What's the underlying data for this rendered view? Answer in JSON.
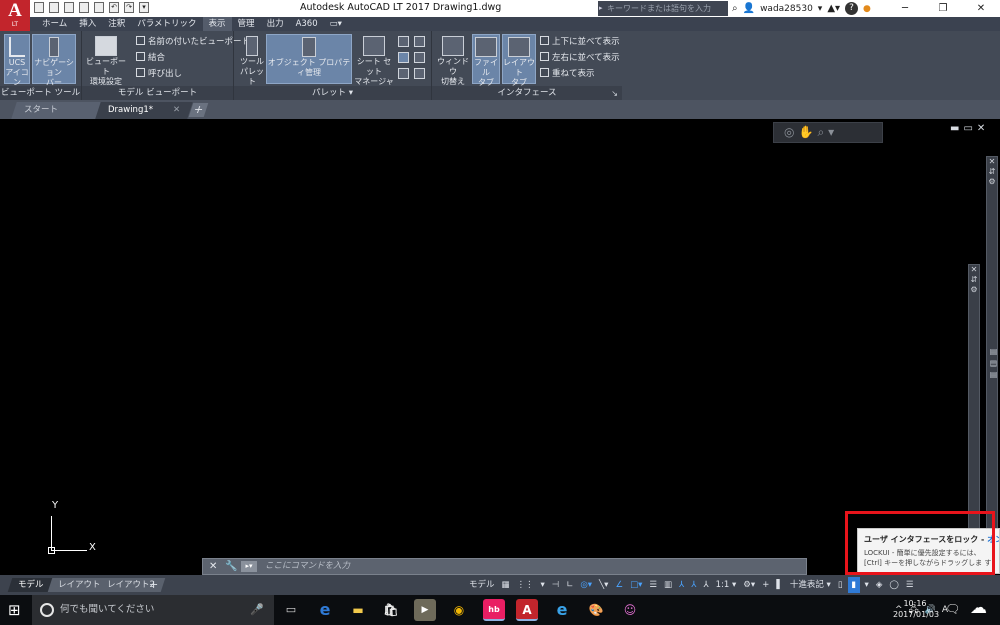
{
  "titlebar": {
    "app_logo_letter": "A",
    "app_logo_sub": "LT",
    "title": "Autodesk AutoCAD LT 2017    Drawing1.dwg",
    "search_placeholder": "キーワードまたは語句を入力",
    "username": "wada28530",
    "help": "?"
  },
  "menu_tabs": [
    "ホーム",
    "挿入",
    "注釈",
    "パラメトリック",
    "表示",
    "管理",
    "出力",
    "A360",
    "▭▾"
  ],
  "menu_active": "表示",
  "ribbon": {
    "viewport_tools": {
      "title": "ビューポート ツール ▾",
      "ucs_icon": "UCS\nアイコン",
      "ucs_l1": "UCS",
      "ucs_l2": "アイコン",
      "nav_l1": "ナビゲーション",
      "nav_l2": "バー"
    },
    "model_viewport": {
      "title": "モデル ビューポート",
      "config_l1": "ビューポート",
      "config_l2": "環境設定",
      "named": "名前の付いたビューポート",
      "join": "結合",
      "restore": "呼び出し"
    },
    "palette": {
      "title": "パレット ▾",
      "tool_l1": "ツール",
      "tool_l2": "パレット",
      "properties": "オブジェクト プロパティ管理",
      "sheetset_l1": "シート セット",
      "sheetset_l2": "マネージャ"
    },
    "interface": {
      "title": "インタフェース",
      "switch_l1": "ウィンドウ",
      "switch_l2": "切替え",
      "filetab_l1": "ファイル",
      "filetab_l2": "タブ",
      "layouttab_l1": "レイアウト",
      "layouttab_l2": "タブ",
      "tile_h": "上下に並べて表示",
      "tile_v": "左右に並べて表示",
      "cascade": "重ねて表示"
    }
  },
  "file_tabs": [
    {
      "label": "スタート",
      "active": false
    },
    {
      "label": "Drawing1*",
      "active": true
    }
  ],
  "file_tab_add": "+",
  "viewport_controls": [
    "▬",
    "▭",
    "✕"
  ],
  "ucs_labels": {
    "x": "X",
    "y": "Y"
  },
  "command_line": {
    "placeholder": "ここにコマンドを入力"
  },
  "tooltip": {
    "title": "ユーザ インタフェースをロック - ",
    "state": "オン",
    "body_line1": "LOCKUI - 簡単に優先設定するには、",
    "body_line2": "[Ctrl] キーを押しながらドラッグしま す"
  },
  "layout_tabs": [
    {
      "label": "モデル",
      "active": true
    },
    {
      "label": "レイアウト1",
      "active": false
    },
    {
      "label": "レイアウト2",
      "active": false
    }
  ],
  "layout_tab_add": "+",
  "status": {
    "model": "モデル",
    "scale": "1:1 ▾",
    "units": "十進表記 ▾"
  },
  "taskbar": {
    "search_placeholder": "何でも聞いてください",
    "time": "10:16",
    "date": "2017/01/03",
    "ime": "A"
  }
}
